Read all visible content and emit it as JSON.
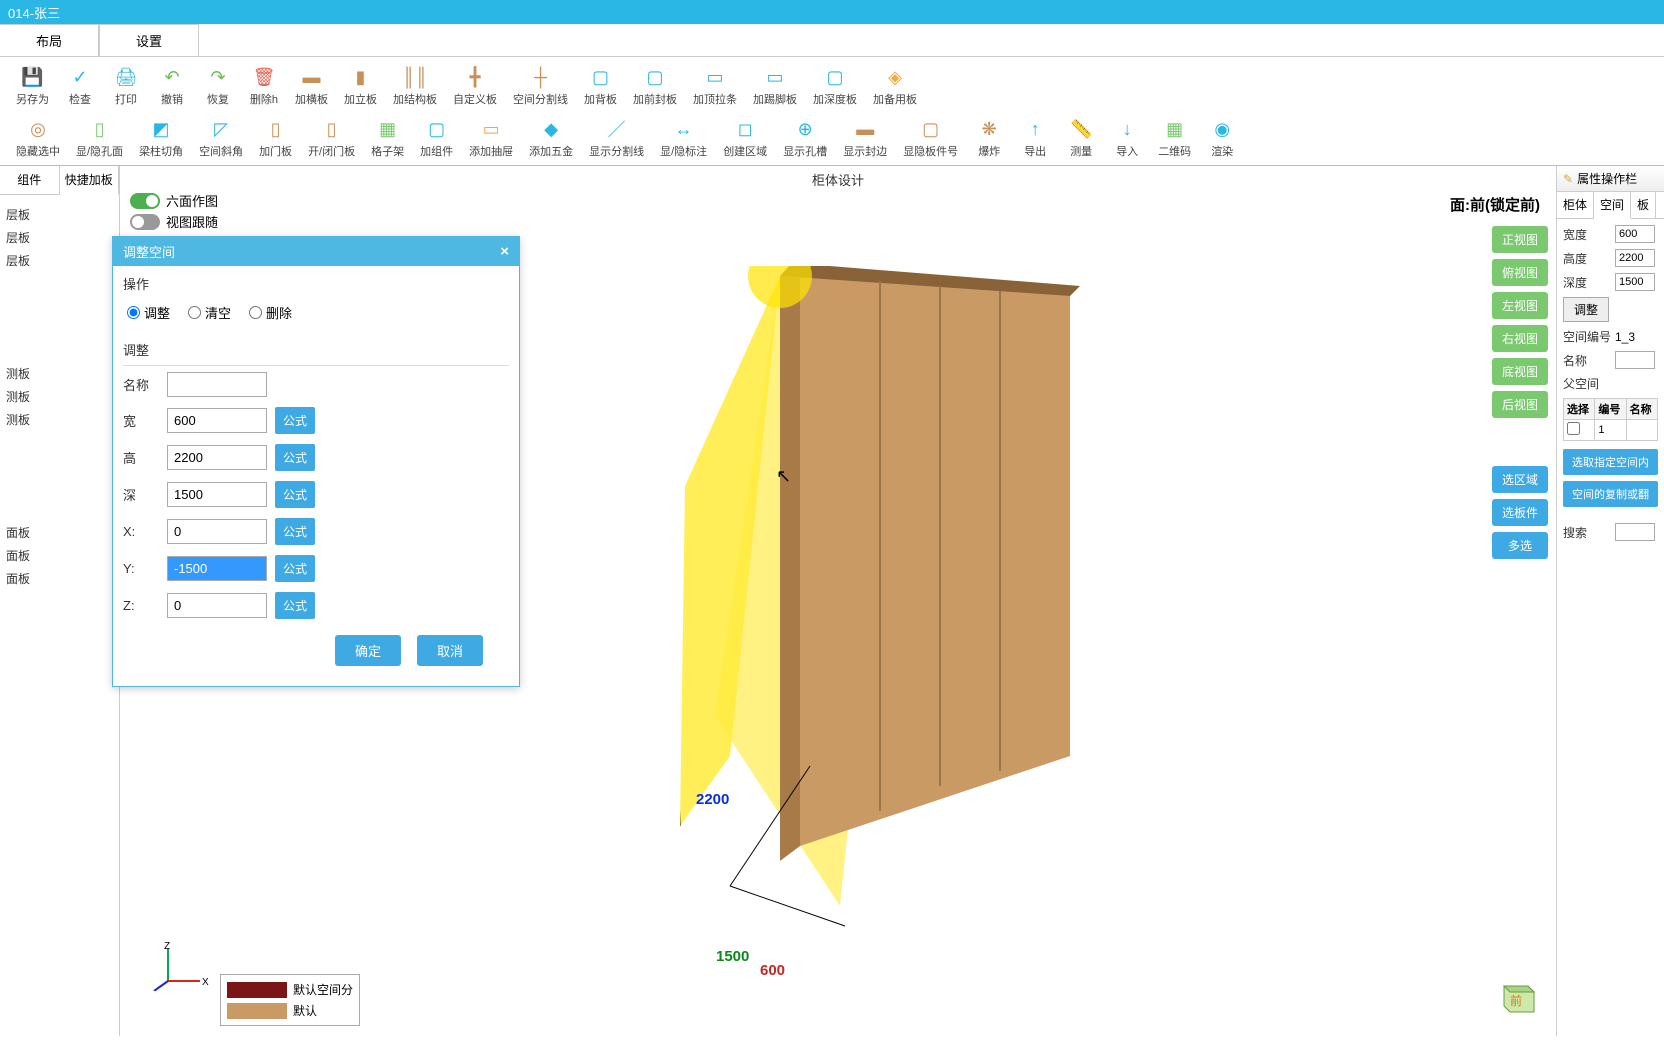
{
  "title_bar": "014-张三",
  "menu_tabs": [
    "布局",
    "设置"
  ],
  "toolbar_row1": [
    {
      "label": "另存为",
      "icon": "💾",
      "color": "#2bb7e5"
    },
    {
      "label": "检查",
      "icon": "✓",
      "color": "#2bb7e5"
    },
    {
      "label": "打印",
      "icon": "🖨",
      "color": "#2bb7e5"
    },
    {
      "label": "撤销",
      "icon": "↶",
      "color": "#6bc04b"
    },
    {
      "label": "恢复",
      "icon": "↷",
      "color": "#6bc04b"
    },
    {
      "label": "删除h",
      "icon": "🗑",
      "color": "#e0604c"
    },
    {
      "label": "加横板",
      "icon": "▬",
      "color": "#c89058"
    },
    {
      "label": "加立板",
      "icon": "▮",
      "color": "#c89058"
    },
    {
      "label": "加结构板",
      "icon": "║║",
      "color": "#c89058"
    },
    {
      "label": "自定义板",
      "icon": "╋",
      "color": "#c89058"
    },
    {
      "label": "空间分割线",
      "icon": "┼",
      "color": "#c89058"
    },
    {
      "label": "加背板",
      "icon": "▢",
      "color": "#2bb7e5"
    },
    {
      "label": "加前封板",
      "icon": "▢",
      "color": "#2bb7e5"
    },
    {
      "label": "加顶拉条",
      "icon": "▭",
      "color": "#2bb7e5"
    },
    {
      "label": "加踢脚板",
      "icon": "▭",
      "color": "#2bb7e5"
    },
    {
      "label": "加深度板",
      "icon": "▢",
      "color": "#2bb7e5"
    },
    {
      "label": "加备用板",
      "icon": "◈",
      "color": "#f4a742"
    }
  ],
  "toolbar_row2": [
    {
      "label": "隐藏选中",
      "icon": "◎",
      "color": "#c89058"
    },
    {
      "label": "显/隐孔面",
      "icon": "▯",
      "color": "#7bc96f"
    },
    {
      "label": "梁柱切角",
      "icon": "◩",
      "color": "#2bb7e5"
    },
    {
      "label": "空间斜角",
      "icon": "◸",
      "color": "#2bb7e5"
    },
    {
      "label": "加门板",
      "icon": "▯",
      "color": "#c89058"
    },
    {
      "label": "开/闭门板",
      "icon": "▯",
      "color": "#c89058"
    },
    {
      "label": "格子架",
      "icon": "▦",
      "color": "#7bc96f"
    },
    {
      "label": "加组件",
      "icon": "▢",
      "color": "#2bb7e5"
    },
    {
      "label": "添加抽屉",
      "icon": "▭",
      "color": "#f4a742"
    },
    {
      "label": "添加五金",
      "icon": "◆",
      "color": "#2bb7e5"
    },
    {
      "label": "显示分割线",
      "icon": "／",
      "color": "#2bb7e5"
    },
    {
      "label": "显/隐标注",
      "icon": "↔",
      "color": "#2bb7e5"
    },
    {
      "label": "创建区域",
      "icon": "◻",
      "color": "#2bb7e5"
    },
    {
      "label": "显示孔槽",
      "icon": "⊕",
      "color": "#2bb7e5"
    },
    {
      "label": "显示封边",
      "icon": "▬",
      "color": "#c89058"
    },
    {
      "label": "显隐板件号",
      "icon": "▢",
      "color": "#c89058"
    },
    {
      "label": "爆炸",
      "icon": "❋",
      "color": "#c89058"
    },
    {
      "label": "导出",
      "icon": "↑",
      "color": "#2bb7e5"
    },
    {
      "label": "测量",
      "icon": "📏",
      "color": "#2bb7e5"
    },
    {
      "label": "导入",
      "icon": "↓",
      "color": "#2bb7e5"
    },
    {
      "label": "二维码",
      "icon": "▦",
      "color": "#7bc96f"
    },
    {
      "label": "渲染",
      "icon": "◉",
      "color": "#2bb7e5"
    }
  ],
  "left_panel": {
    "tabs": [
      "组件",
      "快捷加板"
    ],
    "items": [
      "层板",
      "层板",
      "层板",
      "测板",
      "测板",
      "测板",
      "面板",
      "面板",
      "面板"
    ]
  },
  "canvas": {
    "title": "柜体设计",
    "toggles": [
      {
        "label": "六面作图",
        "on": true
      },
      {
        "label": "视图跟随",
        "on": false
      }
    ],
    "face_lock": "面:前(锁定前)",
    "view_buttons": [
      "正视图",
      "俯视图",
      "左视图",
      "右视图",
      "底视图",
      "后视图"
    ],
    "sel_buttons": [
      "选区域",
      "选板件",
      "多选"
    ],
    "dims": {
      "h": "2200",
      "d": "1500",
      "w": "600"
    },
    "legend": [
      {
        "label": "默认空间分",
        "color": "#7a1616"
      },
      {
        "label": "默认",
        "color": "#c99a64"
      }
    ],
    "axis": {
      "z": "Z",
      "x": "X"
    },
    "nav_cube": "前"
  },
  "dialog": {
    "title": "调整空间",
    "section1": "操作",
    "radios": [
      "调整",
      "清空",
      "删除"
    ],
    "section2": "调整",
    "fields": [
      {
        "label": "名称",
        "value": "",
        "formula": false
      },
      {
        "label": "宽",
        "value": "600",
        "formula": true
      },
      {
        "label": "高",
        "value": "2200",
        "formula": true
      },
      {
        "label": "深",
        "value": "1500",
        "formula": true
      },
      {
        "label": "X:",
        "value": "0",
        "formula": true
      },
      {
        "label": "Y:",
        "value": "-1500",
        "formula": true,
        "selected": true
      },
      {
        "label": "Z:",
        "value": "0",
        "formula": true
      }
    ],
    "formula_label": "公式",
    "ok": "确定",
    "cancel": "取消"
  },
  "right_panel": {
    "title": "属性操作栏",
    "tabs": [
      "柜体",
      "空间",
      "板"
    ],
    "rows": [
      {
        "label": "宽度",
        "value": "600"
      },
      {
        "label": "高度",
        "value": "2200"
      },
      {
        "label": "深度",
        "value": "1500"
      }
    ],
    "adjust_btn": "调整",
    "space_no_label": "空间编号",
    "space_no": "1_3",
    "name_label": "名称",
    "parent_label": "父空间",
    "table_headers": [
      "选择",
      "编号",
      "名称"
    ],
    "table_row": [
      "",
      "1",
      ""
    ],
    "btn_pick": "选取指定空间内",
    "btn_copy": "空间的复制或翻",
    "search_label": "搜索"
  }
}
